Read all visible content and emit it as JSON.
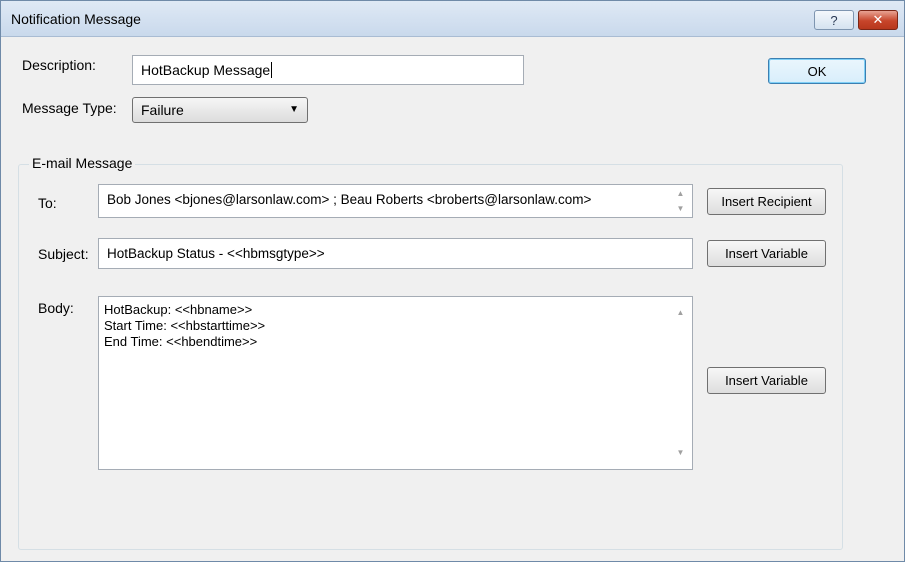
{
  "window": {
    "title": "Notification Message",
    "help_label": "?",
    "close_label": "✕"
  },
  "description": {
    "label": "Description:",
    "value": "HotBackup Message"
  },
  "message_type": {
    "label": "Message Type:",
    "selected": "Failure"
  },
  "ok_label": "OK",
  "email": {
    "group_title": "E-mail Message",
    "to_label": "To:",
    "to_value": "Bob Jones <bjones@larsonlaw.com> ; Beau Roberts <broberts@larsonlaw.com>",
    "insert_recipient_label": "Insert Recipient",
    "subject_label": "Subject:",
    "subject_value": "HotBackup Status - <<hbmsgtype>>",
    "insert_variable_subject_label": "Insert Variable",
    "body_label": "Body:",
    "body_lines": [
      "HotBackup: <<hbname>>",
      "Start Time: <<hbstarttime>>",
      "End Time: <<hbendtime>>"
    ],
    "insert_variable_body_label": "Insert Variable"
  },
  "icons": {
    "scroll_up": "chevron-up-icon",
    "scroll_down": "chevron-down-icon",
    "dropdown": "triangle-down-icon"
  }
}
